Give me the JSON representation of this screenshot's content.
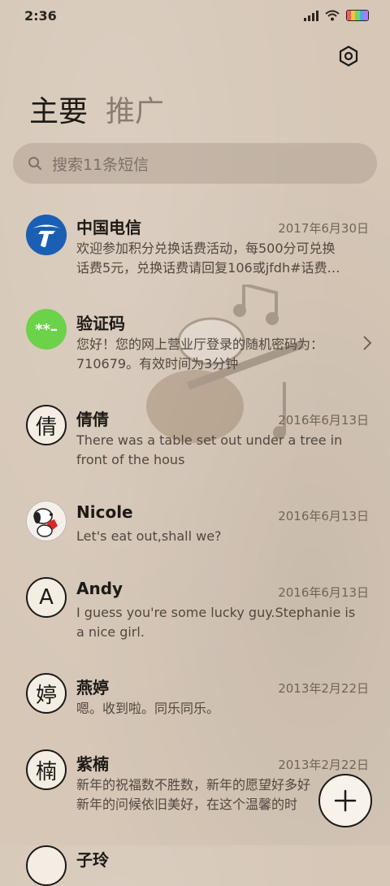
{
  "status_bar": {
    "time": "2:36"
  },
  "tabs": [
    {
      "label": "主要"
    },
    {
      "label": "推广"
    }
  ],
  "search": {
    "placeholder": "搜索11条短信"
  },
  "conversations": [
    {
      "name": "中国电信",
      "date": "2017年6月30日",
      "preview": [
        "欢迎参加积分兑换话费活动，每500分可兑换",
        "话费5元，兑换话费请回复106或jfdh#话费…"
      ],
      "avatar": "china-telecom-logo"
    },
    {
      "name": "验证码",
      "date": "",
      "preview": [
        "您好！您的网上营业厅登录的随机密码为：",
        "710679。有效时间为3分钟"
      ],
      "avatar_text": "**–"
    },
    {
      "name": "倩倩",
      "date": "2016年6月13日",
      "preview": [
        "There was a table set out under a tree in",
        "front of the hous"
      ],
      "avatar_text": "倩"
    },
    {
      "name": "Nicole",
      "date": "2016年6月13日",
      "preview": [
        "Let's eat out,shall we?"
      ],
      "avatar": "snoopy-photo"
    },
    {
      "name": "Andy",
      "date": "2016年6月13日",
      "preview": [
        "I guess you're some lucky guy.Stephanie is",
        "a nice girl."
      ],
      "avatar_text": "A"
    },
    {
      "name": "燕婷",
      "date": "2013年2月22日",
      "preview": [
        "嗯。收到啦。同乐同乐。"
      ],
      "avatar_text": "婷"
    },
    {
      "name": "紫楠",
      "date": "2013年2月22日",
      "preview": [
        "新年的祝福数不胜数，新年的愿望好多好",
        "新年的问候依旧美好，在这个温馨的时"
      ],
      "avatar_text": "楠"
    },
    {
      "name": "子玲",
      "date": "",
      "preview": [],
      "avatar_text": ""
    }
  ],
  "colors": {
    "background": "#d6c7b7",
    "verify_green": "#6cd24a",
    "telecom_blue": "#1a5fb4"
  }
}
